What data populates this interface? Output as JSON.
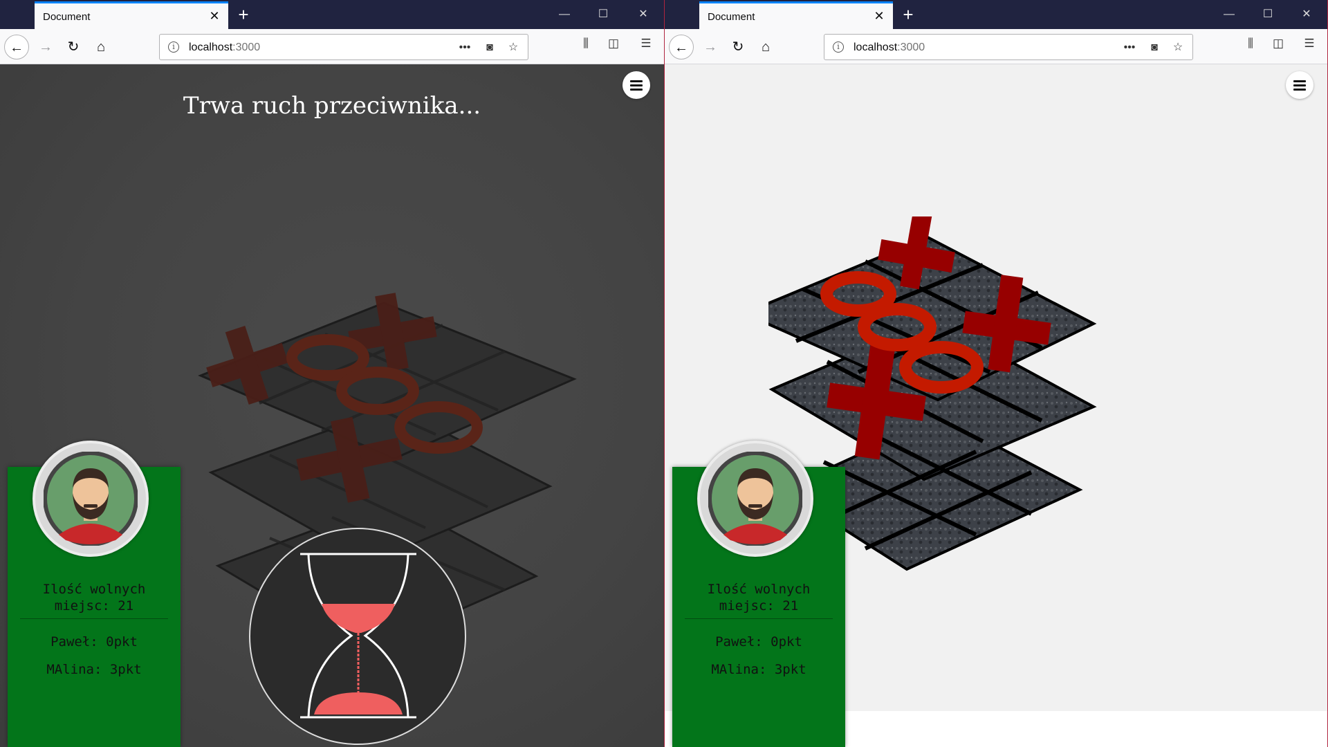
{
  "windows": [
    {
      "tab_title": "Document",
      "url_host": "localhost",
      "url_port": ":3000",
      "turn_text": "Trwa ruch przeciwnika...",
      "card": {
        "free_line1": "Ilość wolnych",
        "free_line2": "miejsc: 21",
        "score1": "Paweł: 0pkt",
        "score2": "MAlina: 3pkt"
      }
    },
    {
      "tab_title": "Document",
      "url_host": "localhost",
      "url_port": ":3000",
      "card": {
        "free_line1": "Ilość wolnych",
        "free_line2": "miejsc: 21",
        "score1": "Paweł: 0pkt",
        "score2": "MAlina: 3pkt"
      }
    }
  ],
  "colors": {
    "card_bg": "#03751a",
    "piece_red": "#c41a00",
    "piece_dark_red": "#8e0000",
    "timer_sand": "#ef5f5f",
    "left_bg": "#444444",
    "right_bg": "#f1f1f1"
  },
  "icons": {
    "back": "arrow-left-icon",
    "forward": "arrow-right-icon",
    "reload": "reload-icon",
    "home": "home-icon",
    "info": "info-icon",
    "more": "more-dots-icon",
    "pocket": "pocket-icon",
    "bookmark": "star-icon",
    "library": "library-icon",
    "sidebar": "sidebar-icon",
    "menu": "hamburger-icon"
  }
}
